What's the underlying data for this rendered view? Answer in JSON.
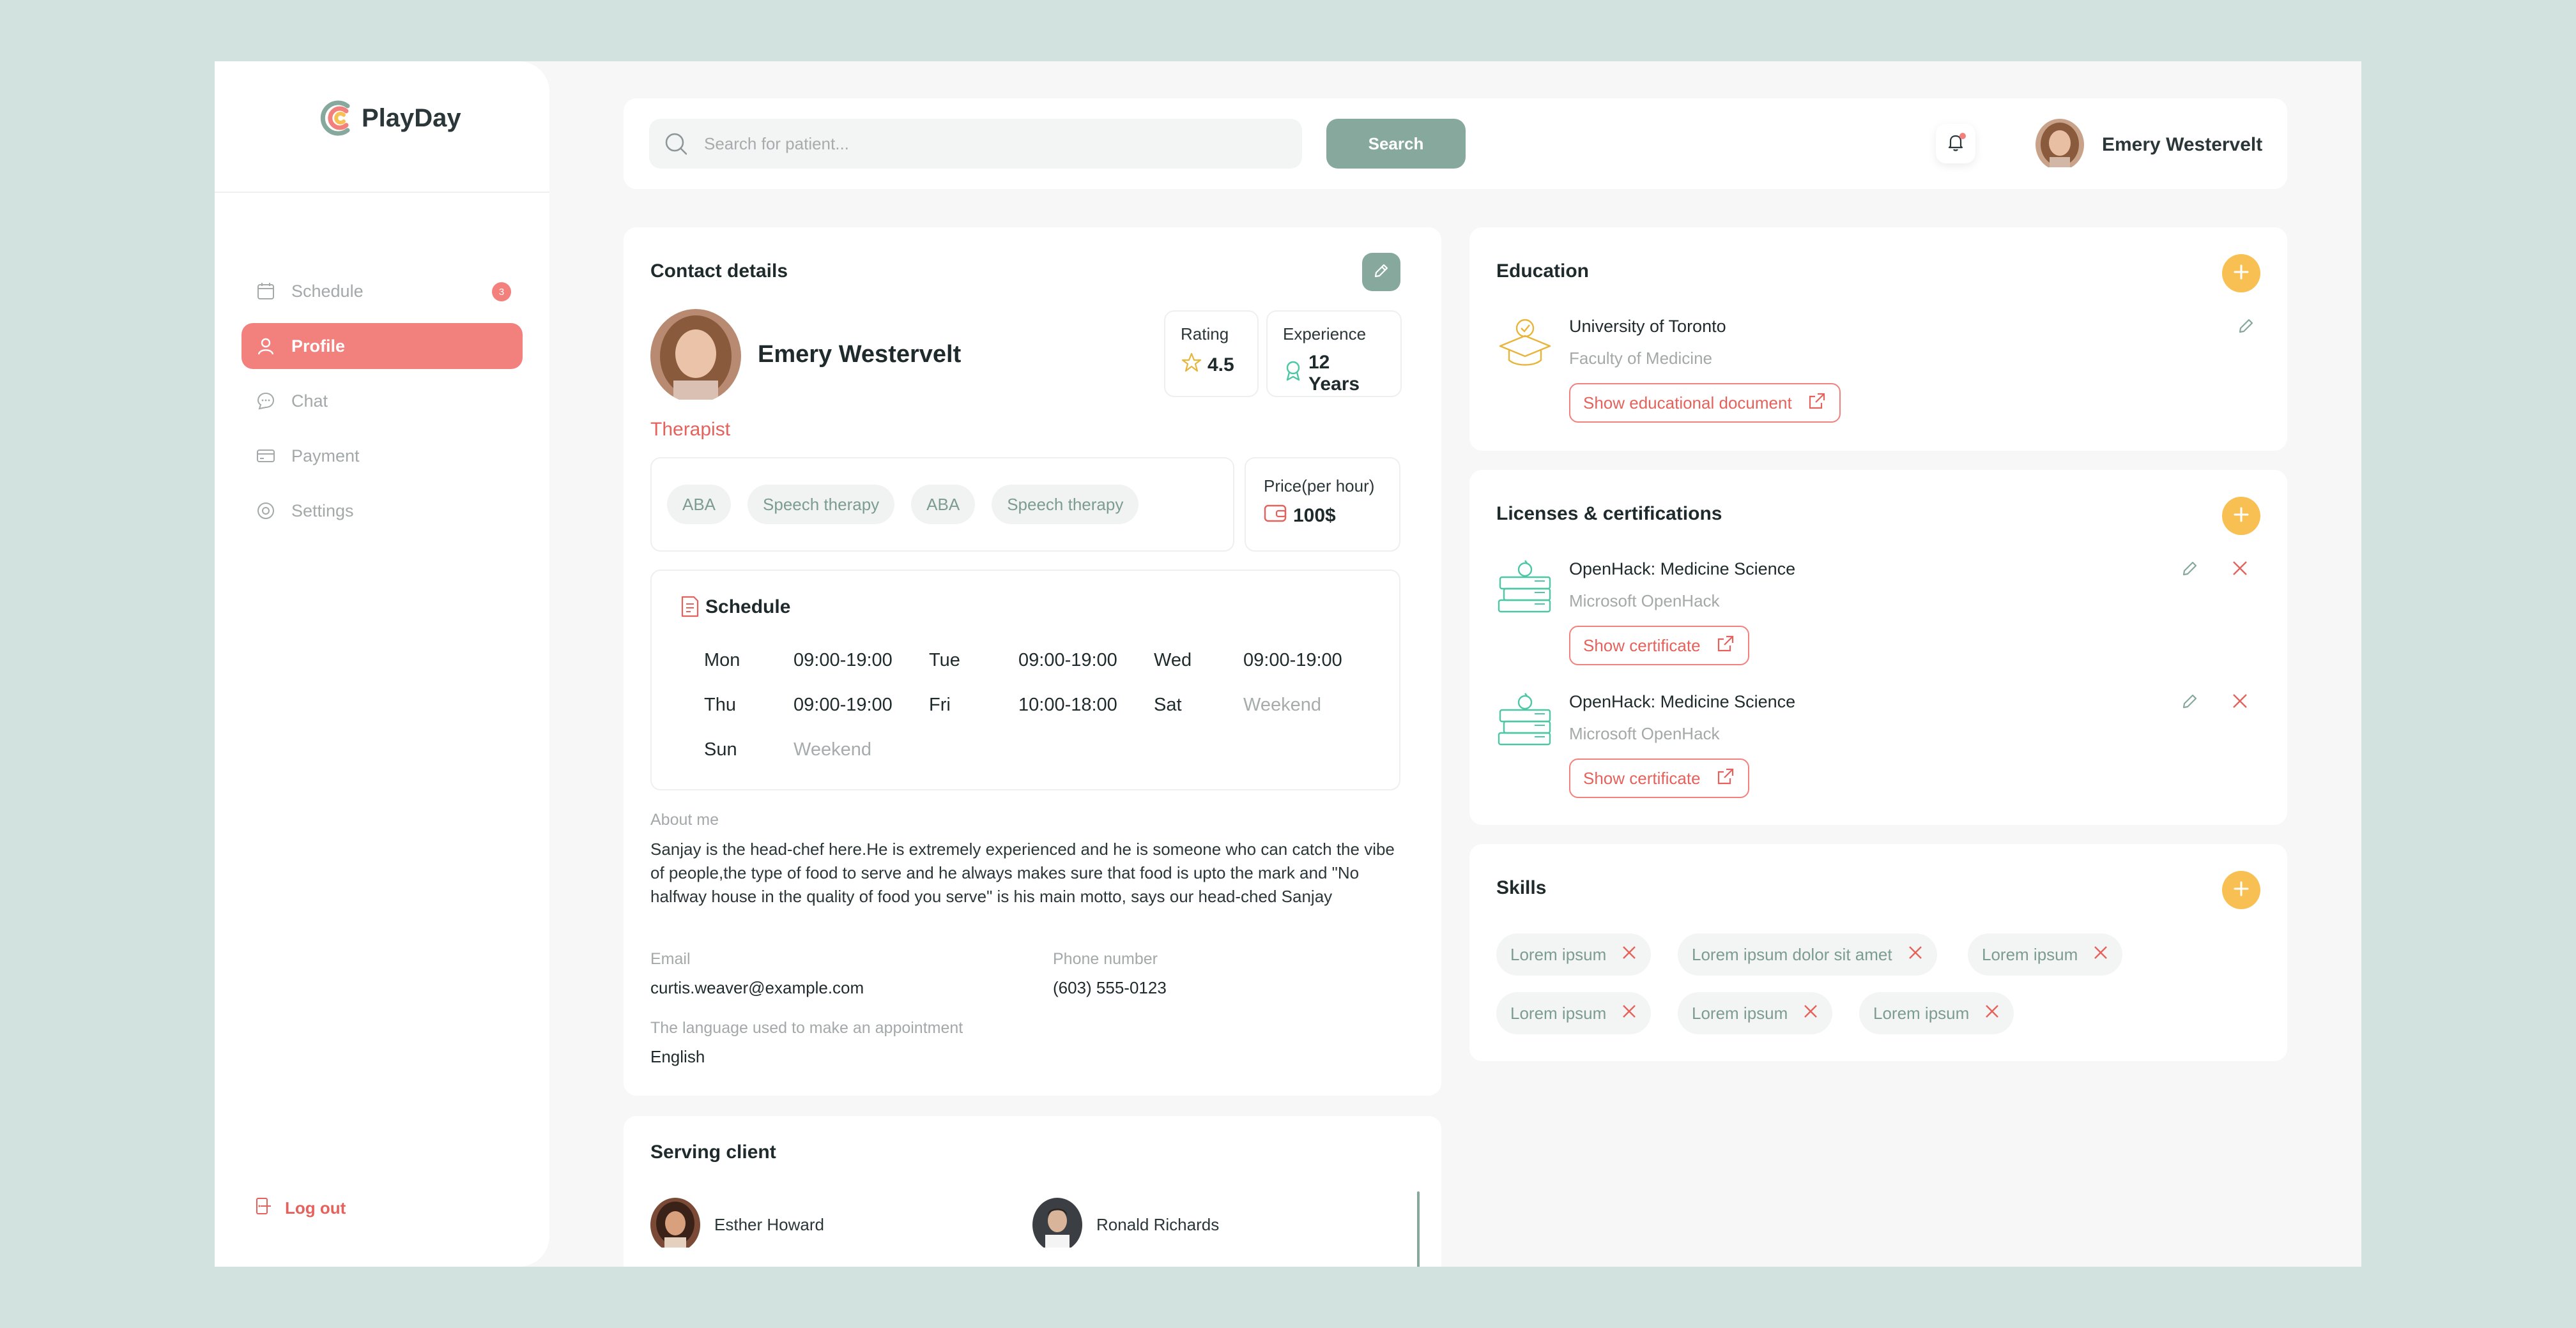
{
  "app": {
    "brand": "PlayDay"
  },
  "sidebar": {
    "items": [
      {
        "label": "Schedule",
        "icon": "calendar-icon",
        "badge": "3"
      },
      {
        "label": "Profile",
        "icon": "user-icon",
        "active": true
      },
      {
        "label": "Chat",
        "icon": "chat-icon"
      },
      {
        "label": "Payment",
        "icon": "credit-card-icon"
      },
      {
        "label": "Settings",
        "icon": "settings-icon"
      }
    ],
    "logout_label": "Log out"
  },
  "topbar": {
    "search_placeholder": "Search for patient...",
    "search_button": "Search",
    "user_name": "Emery Westervelt"
  },
  "contact": {
    "title": "Contact details",
    "name": "Emery Westervelt",
    "role": "Therapist",
    "rating_label": "Rating",
    "rating_value": "4.5",
    "experience_label": "Experience",
    "experience_value": "12 Years",
    "tags": [
      "ABA",
      "Speech therapy",
      "ABA",
      "Speech therapy"
    ],
    "price_label": "Price(per hour)",
    "price_value": "100$",
    "schedule": {
      "title": "Schedule",
      "days": [
        {
          "day": "Mon",
          "hours": "09:00-19:00"
        },
        {
          "day": "Tue",
          "hours": "09:00-19:00"
        },
        {
          "day": "Wed",
          "hours": "09:00-19:00"
        },
        {
          "day": "Thu",
          "hours": "09:00-19:00"
        },
        {
          "day": "Fri",
          "hours": "10:00-18:00"
        },
        {
          "day": "Sat",
          "hours": "Weekend"
        },
        {
          "day": "Sun",
          "hours": "Weekend"
        }
      ]
    },
    "about_label": "About me",
    "about_text": "Sanjay is the head-chef here.He is extremely experienced and he is someone who can catch the vibe of people,the type of food to serve and he always makes sure that food is upto the mark and \"No halfway house in the quality of food you serve\" is his main motto, says our head-ched Sanjay",
    "email_label": "Email",
    "email_value": "curtis.weaver@example.com",
    "phone_label": "Phone number",
    "phone_value": "(603) 555-0123",
    "language_label": "The language used to make an appointment",
    "language_value": "English"
  },
  "serving": {
    "title": "Serving client",
    "clients": [
      "Esther Howard",
      "Ronald Richards"
    ]
  },
  "education": {
    "title": "Education",
    "school": "University of Toronto",
    "faculty": "Faculty of Medicine",
    "doc_button": "Show educational document"
  },
  "licenses": {
    "title": "Licenses & certifications",
    "items": [
      {
        "title": "OpenHack: Medicine Science",
        "issuer": "Microsoft OpenHack",
        "button": "Show certificate"
      },
      {
        "title": "OpenHack: Medicine Science",
        "issuer": "Microsoft OpenHack",
        "button": "Show certificate"
      }
    ]
  },
  "skills": {
    "title": "Skills",
    "items": [
      "Lorem ipsum",
      "Lorem ipsum dolor sit amet",
      "Lorem ipsum",
      "Lorem ipsum",
      "Lorem ipsum",
      "Lorem ipsum"
    ]
  },
  "colors": {
    "accent_green": "#86a89d",
    "accent_red": "#f2807c",
    "accent_yellow": "#f8c052",
    "background": "#d2e2de"
  }
}
